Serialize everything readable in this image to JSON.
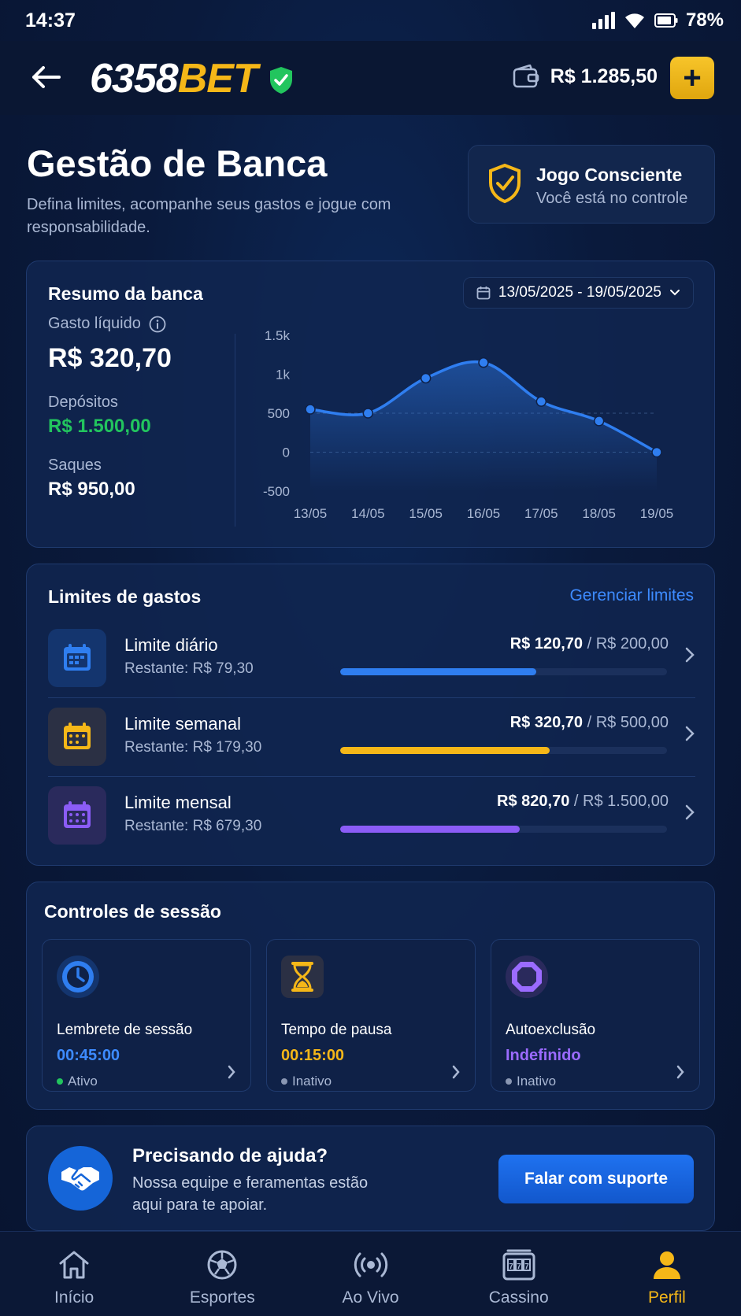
{
  "status_bar": {
    "time": "14:37",
    "battery": "78%"
  },
  "header": {
    "logo_number": "6358",
    "logo_bet": "BET",
    "balance": "R$ 1.285,50",
    "add_label": "+"
  },
  "page": {
    "title": "Gestão de Banca",
    "subtitle": "Defina limites, acompanhe seus gastos e jogue com responsabilidade."
  },
  "conscious": {
    "title": "Jogo Consciente",
    "subtitle": "Você está no controle"
  },
  "summary": {
    "title": "Resumo da banca",
    "date_range": "13/05/2025 - 19/05/2025",
    "net_label": "Gasto líquido",
    "net_value": "R$ 320,70",
    "deposits_label": "Depósitos",
    "deposits_value": "R$ 1.500,00",
    "withdrawals_label": "Saques",
    "withdrawals_value": "R$ 950,00"
  },
  "chart_data": {
    "type": "line",
    "categories": [
      "13/05",
      "14/05",
      "15/05",
      "16/05",
      "17/05",
      "18/05",
      "19/05"
    ],
    "values": [
      550,
      500,
      950,
      1150,
      650,
      400,
      0
    ],
    "y_ticks": [
      "1.5k",
      "1k",
      "500",
      "0",
      "-500"
    ],
    "ylim": [
      -500,
      1500
    ],
    "color": "#2f7ef0"
  },
  "limits": {
    "title": "Limites de gastos",
    "manage_label": "Gerenciar limites",
    "items": [
      {
        "name": "Limite diário",
        "rest": "Restante: R$ 79,30",
        "used": "R$ 120,70",
        "total": " / R$ 200,00",
        "progress": 0.6,
        "color": "#2f7ef0",
        "bg": "#14356e"
      },
      {
        "name": "Limite semanal",
        "rest": "Restante: R$ 179,30",
        "used": "R$ 320,70",
        "total": " / R$ 500,00",
        "progress": 0.64,
        "color": "#f5b718",
        "bg": "#2b3044"
      },
      {
        "name": "Limite mensal",
        "rest": "Restante: R$ 679,30",
        "used": "R$ 820,70",
        "total": " / R$ 1.500,00",
        "progress": 0.55,
        "color": "#8b5cf6",
        "bg": "#2a2a5c"
      }
    ]
  },
  "session": {
    "title": "Controles de sessão",
    "items": [
      {
        "name": "Lembrete de sessão",
        "value": "00:45:00",
        "status": "Ativo",
        "color": "#3d8bff",
        "dot": "#22c55e"
      },
      {
        "name": "Tempo de pausa",
        "value": "00:15:00",
        "status": "Inativo",
        "color": "#f5b718",
        "dot": "#8a97b3"
      },
      {
        "name": "Autoexclusão",
        "value": "Indefinido",
        "status": "Inativo",
        "color": "#9b6bff",
        "dot": "#8a97b3"
      }
    ]
  },
  "help": {
    "title": "Precisando de ajuda?",
    "text": "Nossa equipe e feramentas estão aqui para te apoiar.",
    "button": "Falar com suporte"
  },
  "nav": {
    "items": [
      {
        "label": "Início",
        "icon": "home-icon"
      },
      {
        "label": "Esportes",
        "icon": "soccer-ball-icon"
      },
      {
        "label": "Ao Vivo",
        "icon": "live-broadcast-icon"
      },
      {
        "label": "Cassino",
        "icon": "slot-machine-icon"
      },
      {
        "label": "Perfil",
        "icon": "user-icon"
      }
    ],
    "active": "Perfil"
  }
}
